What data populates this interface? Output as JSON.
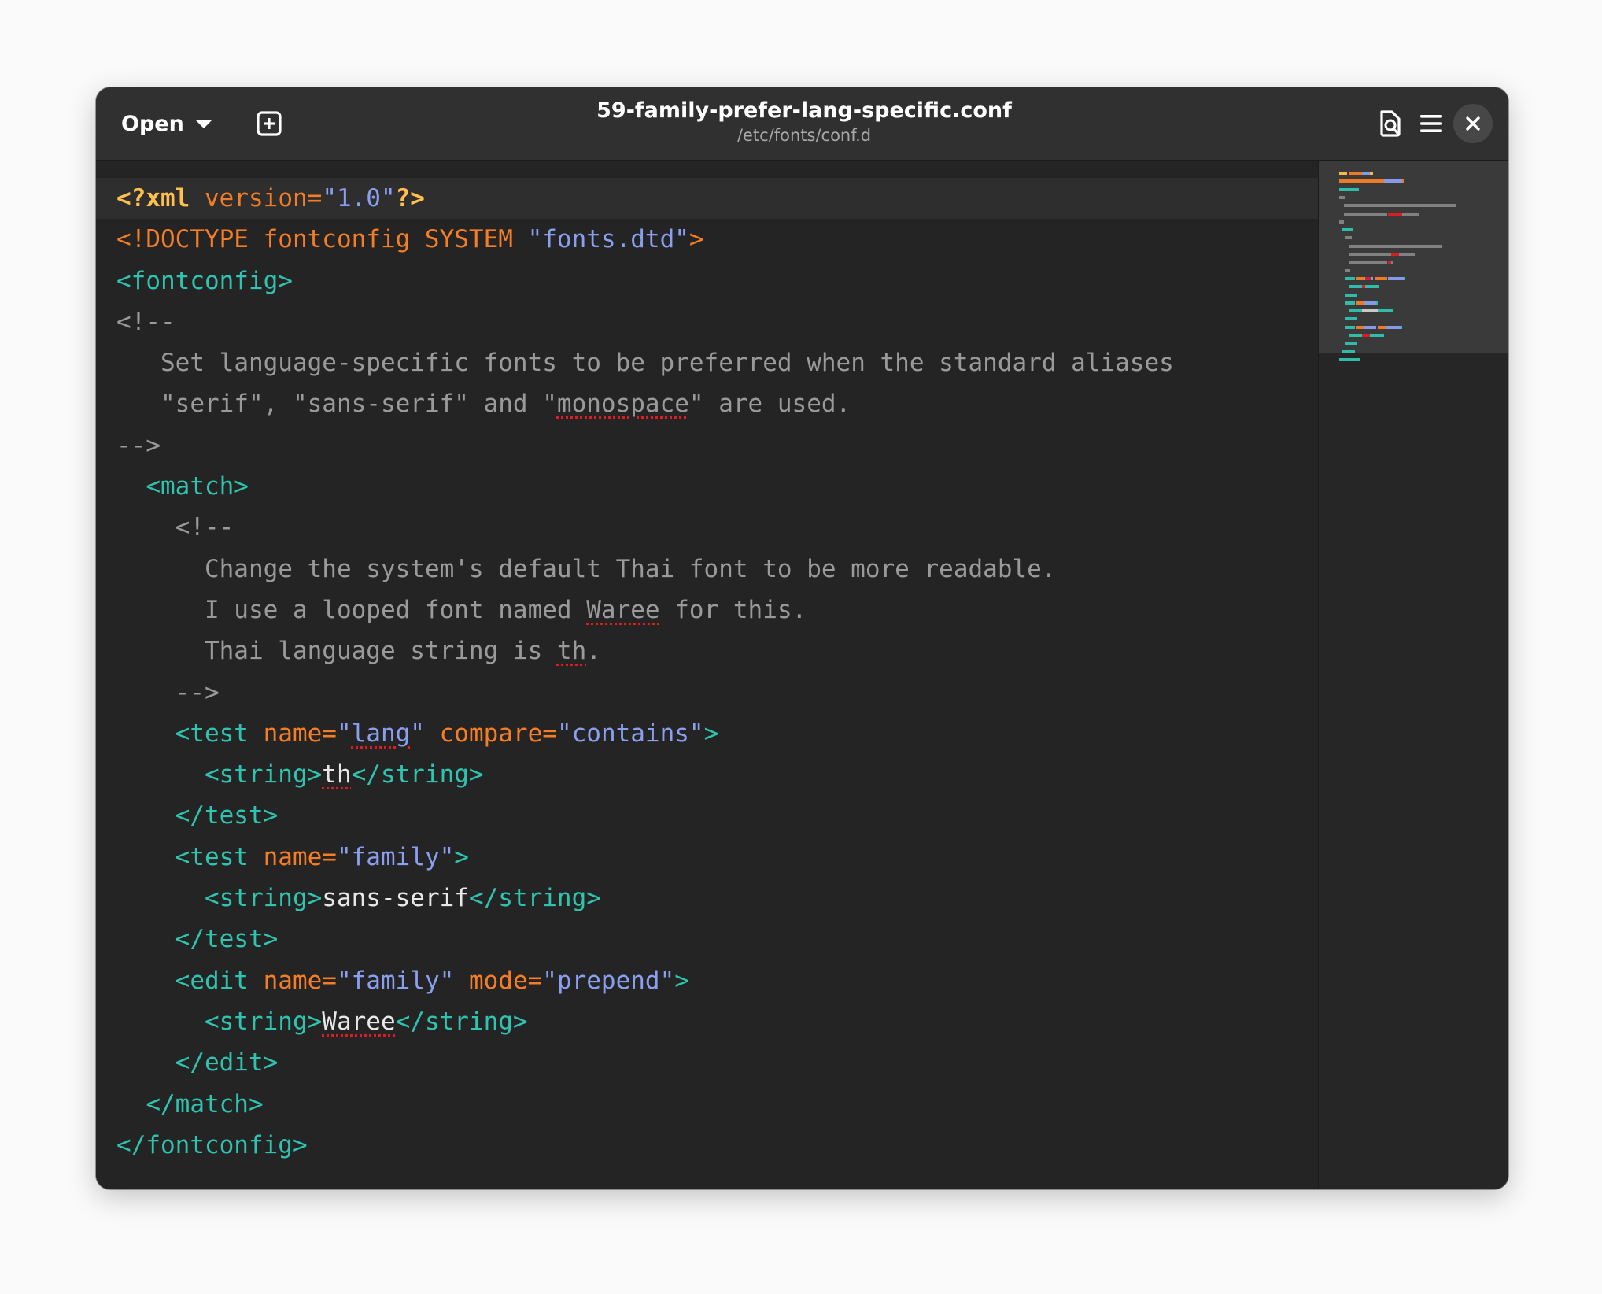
{
  "header": {
    "open_label": "Open",
    "title": "59-family-prefer-lang-specific.conf",
    "subtitle": "/etc/fonts/conf.d"
  },
  "icons": {
    "open_caret": "pan-down-icon",
    "new_tab": "tab-new-icon",
    "document_status": "document-icon",
    "menu": "hamburger-menu-icon",
    "close": "close-icon"
  },
  "colors": {
    "processing_instruction": "#ffc04d",
    "attribute": "#f57d25",
    "string": "#8a9ff0",
    "tag": "#2ec4b0",
    "comment": "#9a9a9a",
    "spell_error": "#e01b24"
  },
  "editor": {
    "lines": [
      {
        "indent": "",
        "tokens": [
          {
            "c": "pi",
            "t": "<?xml"
          },
          {
            "c": "text",
            "t": " "
          },
          {
            "c": "attr",
            "t": "version="
          },
          {
            "c": "str",
            "t": "\"1.0\""
          },
          {
            "c": "pi",
            "t": "?>"
          }
        ]
      },
      {
        "indent": "",
        "tokens": [
          {
            "c": "doctype",
            "t": "<!DOCTYPE fontconfig SYSTEM "
          },
          {
            "c": "str",
            "t": "\"fonts.dtd\""
          },
          {
            "c": "doctype",
            "t": ">"
          }
        ]
      },
      {
        "indent": "",
        "tokens": [
          {
            "c": "tag",
            "t": "<fontconfig>"
          }
        ]
      },
      {
        "indent": "",
        "tokens": [
          {
            "c": "comment",
            "t": "<!--"
          }
        ]
      },
      {
        "indent": "   ",
        "tokens": [
          {
            "c": "comment",
            "t": "Set language-specific fonts to be preferred when the standard aliases"
          }
        ]
      },
      {
        "indent": "   ",
        "tokens": [
          {
            "c": "comment",
            "t": "\"serif\", \"sans-serif\" and \""
          },
          {
            "c": "comment spell",
            "t": "monospace"
          },
          {
            "c": "comment",
            "t": "\" are used."
          }
        ]
      },
      {
        "indent": "",
        "tokens": [
          {
            "c": "comment",
            "t": "-->"
          }
        ]
      },
      {
        "indent": "  ",
        "tokens": [
          {
            "c": "tag",
            "t": "<match>"
          }
        ]
      },
      {
        "indent": "    ",
        "tokens": [
          {
            "c": "comment",
            "t": "<!--"
          }
        ]
      },
      {
        "indent": "      ",
        "tokens": [
          {
            "c": "comment",
            "t": "Change the system's default Thai font to be more readable."
          }
        ]
      },
      {
        "indent": "      ",
        "tokens": [
          {
            "c": "comment",
            "t": "I use a looped font named "
          },
          {
            "c": "comment spell",
            "t": "Waree"
          },
          {
            "c": "comment",
            "t": " for this."
          }
        ]
      },
      {
        "indent": "      ",
        "tokens": [
          {
            "c": "comment",
            "t": "Thai language string is "
          },
          {
            "c": "comment spell",
            "t": "th"
          },
          {
            "c": "comment",
            "t": "."
          }
        ]
      },
      {
        "indent": "    ",
        "tokens": [
          {
            "c": "comment",
            "t": "-->"
          }
        ]
      },
      {
        "indent": "    ",
        "tokens": [
          {
            "c": "tag",
            "t": "<test "
          },
          {
            "c": "attr",
            "t": "name="
          },
          {
            "c": "str",
            "t": "\""
          },
          {
            "c": "str spell",
            "t": "lang"
          },
          {
            "c": "str",
            "t": "\""
          },
          {
            "c": "text",
            "t": " "
          },
          {
            "c": "attr",
            "t": "compare="
          },
          {
            "c": "str",
            "t": "\"contains\""
          },
          {
            "c": "tag",
            "t": ">"
          }
        ]
      },
      {
        "indent": "      ",
        "tokens": [
          {
            "c": "tag",
            "t": "<string>"
          },
          {
            "c": "text spell",
            "t": "th"
          },
          {
            "c": "tag",
            "t": "</string>"
          }
        ]
      },
      {
        "indent": "    ",
        "tokens": [
          {
            "c": "tag",
            "t": "</test>"
          }
        ]
      },
      {
        "indent": "    ",
        "tokens": [
          {
            "c": "tag",
            "t": "<test "
          },
          {
            "c": "attr",
            "t": "name="
          },
          {
            "c": "str",
            "t": "\"family\""
          },
          {
            "c": "tag",
            "t": ">"
          }
        ]
      },
      {
        "indent": "      ",
        "tokens": [
          {
            "c": "tag",
            "t": "<string>"
          },
          {
            "c": "text",
            "t": "sans-serif"
          },
          {
            "c": "tag",
            "t": "</string>"
          }
        ]
      },
      {
        "indent": "    ",
        "tokens": [
          {
            "c": "tag",
            "t": "</test>"
          }
        ]
      },
      {
        "indent": "    ",
        "tokens": [
          {
            "c": "tag",
            "t": "<edit "
          },
          {
            "c": "attr",
            "t": "name="
          },
          {
            "c": "str",
            "t": "\"family\""
          },
          {
            "c": "text",
            "t": " "
          },
          {
            "c": "attr",
            "t": "mode="
          },
          {
            "c": "str",
            "t": "\"prepend\""
          },
          {
            "c": "tag",
            "t": ">"
          }
        ]
      },
      {
        "indent": "      ",
        "tokens": [
          {
            "c": "tag",
            "t": "<string>"
          },
          {
            "c": "text spell",
            "t": "Waree"
          },
          {
            "c": "tag",
            "t": "</string>"
          }
        ]
      },
      {
        "indent": "    ",
        "tokens": [
          {
            "c": "tag",
            "t": "</edit>"
          }
        ]
      },
      {
        "indent": "  ",
        "tokens": [
          {
            "c": "tag",
            "t": "</match>"
          }
        ]
      },
      {
        "indent": "",
        "tokens": [
          {
            "c": "tag",
            "t": "</fontconfig>"
          }
        ]
      }
    ]
  }
}
